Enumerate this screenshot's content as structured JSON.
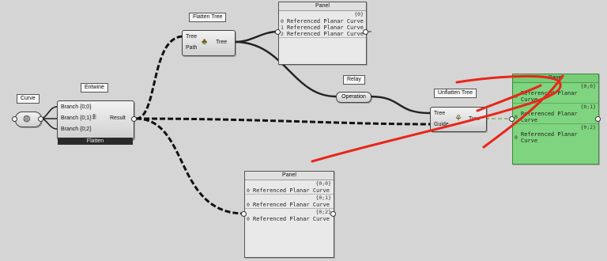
{
  "curve": {
    "tag": "Curve"
  },
  "entwine": {
    "tag": "Entwine",
    "inputs": [
      "Branch {0;0}",
      "Branch {0;1}",
      "Branch {0;2}"
    ],
    "output": "Result",
    "footer": "Flatten"
  },
  "flatten_tree": {
    "tag": "Flatten Tree",
    "inputs": [
      "Tree",
      "Path"
    ],
    "output": "Tree"
  },
  "relay": {
    "tag": "Relay",
    "label": "Operation"
  },
  "unflatten_tree": {
    "tag": "Unflatten Tree",
    "inputs": [
      "Tree",
      "Guide"
    ],
    "output": "Tree"
  },
  "panel_top": {
    "title": "Panel",
    "branches": [
      {
        "path": "{0}",
        "items": [
          {
            "index": "0",
            "text": "Referenced Planar Curve"
          },
          {
            "index": "1",
            "text": "Referenced Planar Curve"
          },
          {
            "index": "2",
            "text": "Referenced Planar Curve"
          }
        ]
      }
    ]
  },
  "panel_bottom": {
    "title": "Panel",
    "branches": [
      {
        "path": "{0;0}",
        "items": [
          {
            "index": "0",
            "text": "Referenced Planar Curve"
          }
        ]
      },
      {
        "path": "{0;1}",
        "items": [
          {
            "index": "0",
            "text": "Referenced Planar Curve"
          }
        ]
      },
      {
        "path": "{0;2}",
        "items": [
          {
            "index": "0",
            "text": "Referenced Planar Curve"
          }
        ]
      }
    ]
  },
  "panel_right": {
    "title": "Panel",
    "branches": [
      {
        "path": "{0;0}",
        "items": [
          {
            "index": "0",
            "text": "Referenced Planar Curve"
          }
        ]
      },
      {
        "path": "{0;1}",
        "items": [
          {
            "index": "0",
            "text": "Referenced Planar Curve"
          }
        ]
      },
      {
        "path": "{0;2}",
        "items": [
          {
            "index": "0",
            "text": "Referenced Planar Curve"
          }
        ]
      }
    ]
  },
  "colors": {
    "canvas": "#d5d5d5",
    "panel_green": "#7fd57f",
    "annotation_red": "#e8261a"
  },
  "icons": {
    "curve": "curve-param-icon",
    "entwine": "entwine-icon",
    "flatten": "flatten-tree-icon",
    "unflatten": "unflatten-tree-icon"
  }
}
